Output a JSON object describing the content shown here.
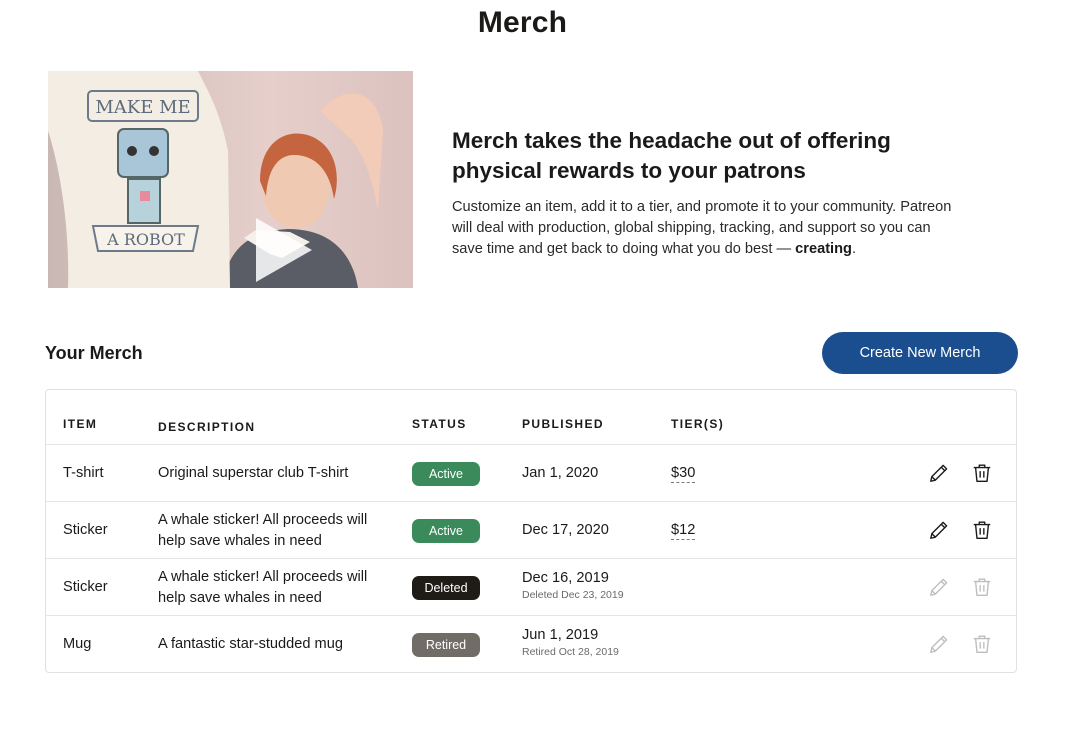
{
  "page": {
    "title": "Merch"
  },
  "intro": {
    "heading": "Merch takes the headache out of offering physical rewards to your patrons",
    "body": "Customize an item, add it to a tier, and promote it to your community. Patreon will deal with production, global shipping, tracking, and support so you can save time and get back to doing what you do best — ",
    "body_bold": "creating",
    "body_end": "."
  },
  "video": {
    "shirt_text_top": "MAKE ME",
    "shirt_text_bottom": "A ROBOT"
  },
  "section": {
    "title": "Your Merch",
    "create_button": "Create New Merch"
  },
  "colors": {
    "accent": "#1a4e8e",
    "active": "#3a8a5c",
    "deleted": "#1f1c17",
    "retired": "#716d66"
  },
  "table": {
    "headers": {
      "item": "ITEM",
      "description": "DESCRIPTION",
      "status": "STATUS",
      "published": "PUBLISHED",
      "tiers": "TIER(S)"
    },
    "rows": [
      {
        "item": "T-shirt",
        "description": "Original superstar club T-shirt",
        "status": "Active",
        "published": "Jan 1, 2020",
        "sub": "",
        "tier": "$30"
      },
      {
        "item": "Sticker",
        "description": "A whale sticker! All proceeds will help save whales in need",
        "status": "Active",
        "published": "Dec 17, 2020",
        "sub": "",
        "tier": "$12"
      },
      {
        "item": "Sticker",
        "description": "A whale sticker! All proceeds will help save whales in need",
        "status": "Deleted",
        "published": "Dec 16, 2019",
        "sub": "Deleted Dec 23, 2019",
        "tier": ""
      },
      {
        "item": "Mug",
        "description": "A fantastic star-studded mug",
        "status": "Retired",
        "published": "Jun 1, 2019",
        "sub": "Retired Oct 28, 2019",
        "tier": ""
      }
    ]
  }
}
